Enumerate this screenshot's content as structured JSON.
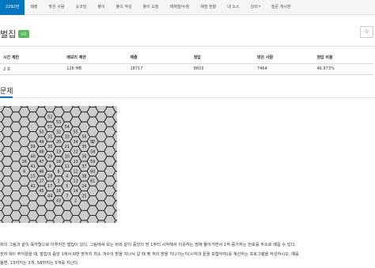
{
  "nav": {
    "items": [
      {
        "label": "2292번",
        "active": true,
        "name": "nav-problem-number"
      },
      {
        "label": "제출",
        "active": false,
        "name": "nav-submit"
      },
      {
        "label": "맞은 사람",
        "active": false,
        "name": "nav-correct-users"
      },
      {
        "label": "숏코딩",
        "active": false,
        "name": "nav-short-coding"
      },
      {
        "label": "풀이",
        "active": false,
        "name": "nav-solutions"
      },
      {
        "label": "풀이 작성",
        "active": false,
        "name": "nav-write-solution"
      },
      {
        "label": "풀이 요청",
        "active": false,
        "name": "nav-request-solution"
      },
      {
        "label": "재채점/수정",
        "active": false,
        "name": "nav-rejudge"
      },
      {
        "label": "채점 현황",
        "active": false,
        "name": "nav-status"
      },
      {
        "label": "내 소스",
        "active": false,
        "name": "nav-my-source"
      },
      {
        "label": "강의",
        "active": false,
        "name": "nav-lectures",
        "dropdown": true
      },
      {
        "label": "질문 게시판",
        "active": false,
        "name": "nav-board"
      }
    ]
  },
  "problem": {
    "title": "벌집",
    "badge": "성공",
    "star_icon": "☆"
  },
  "info_table": {
    "headers": [
      "시간 제한",
      "메모리 제한",
      "제출",
      "정답",
      "맞은 사람",
      "정답 비율"
    ],
    "row": [
      "2 초",
      "128 MB",
      "18717",
      "8603",
      "7464",
      "46.973%"
    ]
  },
  "section": {
    "title": "문제"
  },
  "figure": {
    "numbers": [
      "52",
      "53",
      "54",
      "55",
      "56",
      "57",
      "58",
      "59",
      "60",
      "61",
      "51",
      "32",
      "33",
      "34",
      "35",
      "36",
      "37",
      "50",
      "31",
      "20",
      "21",
      "22",
      "23",
      "38",
      "49",
      "30",
      "19",
      "10",
      "11",
      "12",
      "24",
      "39",
      "48",
      "29",
      "18",
      "9",
      "4",
      "13",
      "25",
      "40",
      "47",
      "28",
      "17",
      "8",
      "3",
      "5",
      "14",
      "26",
      "41",
      "46",
      "27",
      "16",
      "7",
      "2",
      "6",
      "15",
      "42",
      "45",
      "44",
      "43",
      "1"
    ]
  },
  "description": {
    "lines": [
      "위의 그림과 같이 육각형으로 이루어진 벌집이 있다. 그림에서 보는 바와 같이 중앙의 방 1부터 시작해서 이웃하는 방에 돌아가면서 1씩 증가하는 번호를 주소로 매길 수 있다.",
      "숫자 N이 주어졌을 때, 벌집의 중앙 1에서 N번 방까지 최소 개수의 방을 지나서 갈 때 몇 개의 방을 지나가는지(시작과 끝을 포함하여)를 계산하는 프로그램을 작성하시오. 예를",
      "들면, 13까지는 3개, 58까지는 5개를 지난다."
    ]
  }
}
